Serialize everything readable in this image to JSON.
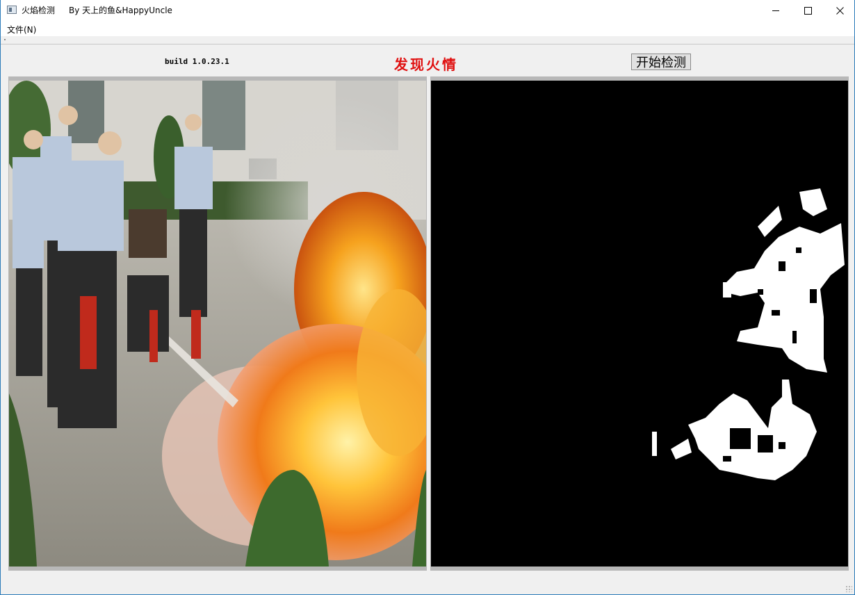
{
  "window": {
    "title": "火焰检测",
    "author": "By 天上的鱼&HappyUncle",
    "controls": {
      "minimize_icon": "minimize-icon",
      "maximize_icon": "maximize-icon",
      "close_icon": "close-icon"
    }
  },
  "menu": {
    "file_label": "文件(N)"
  },
  "toolbar": {
    "build_label": "build 1.0.23.1",
    "alert_label": "发现火情",
    "alert_color": "#e01010",
    "start_button_label": "开始检测"
  },
  "panels": {
    "source_image": "fire-extinguisher-photo",
    "mask_image": "fire-detection-binary-mask"
  }
}
